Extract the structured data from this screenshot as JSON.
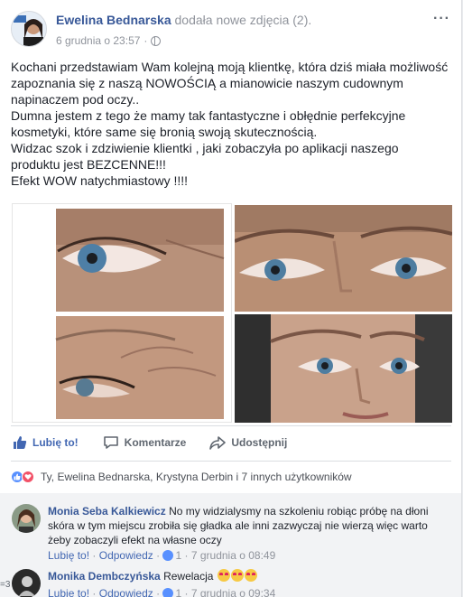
{
  "post": {
    "author": "Ewelina Bednarska",
    "action": "dodała nowe zdjęcia (2).",
    "timestamp": "6 grudnia o 23:57",
    "more": "···",
    "text_lines": [
      "Kochani przedstawiam Wam kolejną moją klientkę, która dziś miała możliwość",
      "zapoznania się z naszą NOWOŚCIĄ a mianowicie naszym cudownym",
      "napinaczem pod oczy..",
      "Dumna jestem z tego że mamy tak fantastyczne i obłędnie perfekcyjne",
      "kosmetyki, które same się bronią swoją skutecznością.",
      "Widzac szok i zdziwienie klientki , jaki zobaczyła po aplikacji naszego",
      "produktu jest BEZCENNE!!!",
      "Efekt WOW natychmiastowy !!!!"
    ]
  },
  "actions": {
    "like": "Lubię to!",
    "comment": "Komentarze",
    "share": "Udostępnij"
  },
  "reactions": {
    "summary": "Ty, Ewelina Bednarska, Krystyna Derbin i 7 innych użytkowników"
  },
  "comments": [
    {
      "author": "Monia Seba Kalkiewicz",
      "line1": "No my widzialysmy na szkoleniu robiąc próbę na dłoni",
      "line2": "skóra w tym miejscu zrobiła się gładka ale inni zazwyczaj nie wierzą więc warto",
      "line3": "żeby zobaczyli efekt na własne oczy",
      "like": "Lubię to!",
      "reply": "Odpowiedz",
      "likes": "1",
      "time": "7 grudnia o 08:49"
    },
    {
      "author": "Monika Dembczyńska",
      "line1": "Rewelacja",
      "like": "Lubię to!",
      "reply": "Odpowiedz",
      "likes": "1",
      "time": "7 grudnia o 09:34"
    }
  ],
  "edge_text": "=3",
  "colors": {
    "link": "#385898",
    "accent": "#4267b2",
    "muted": "#90949c"
  }
}
